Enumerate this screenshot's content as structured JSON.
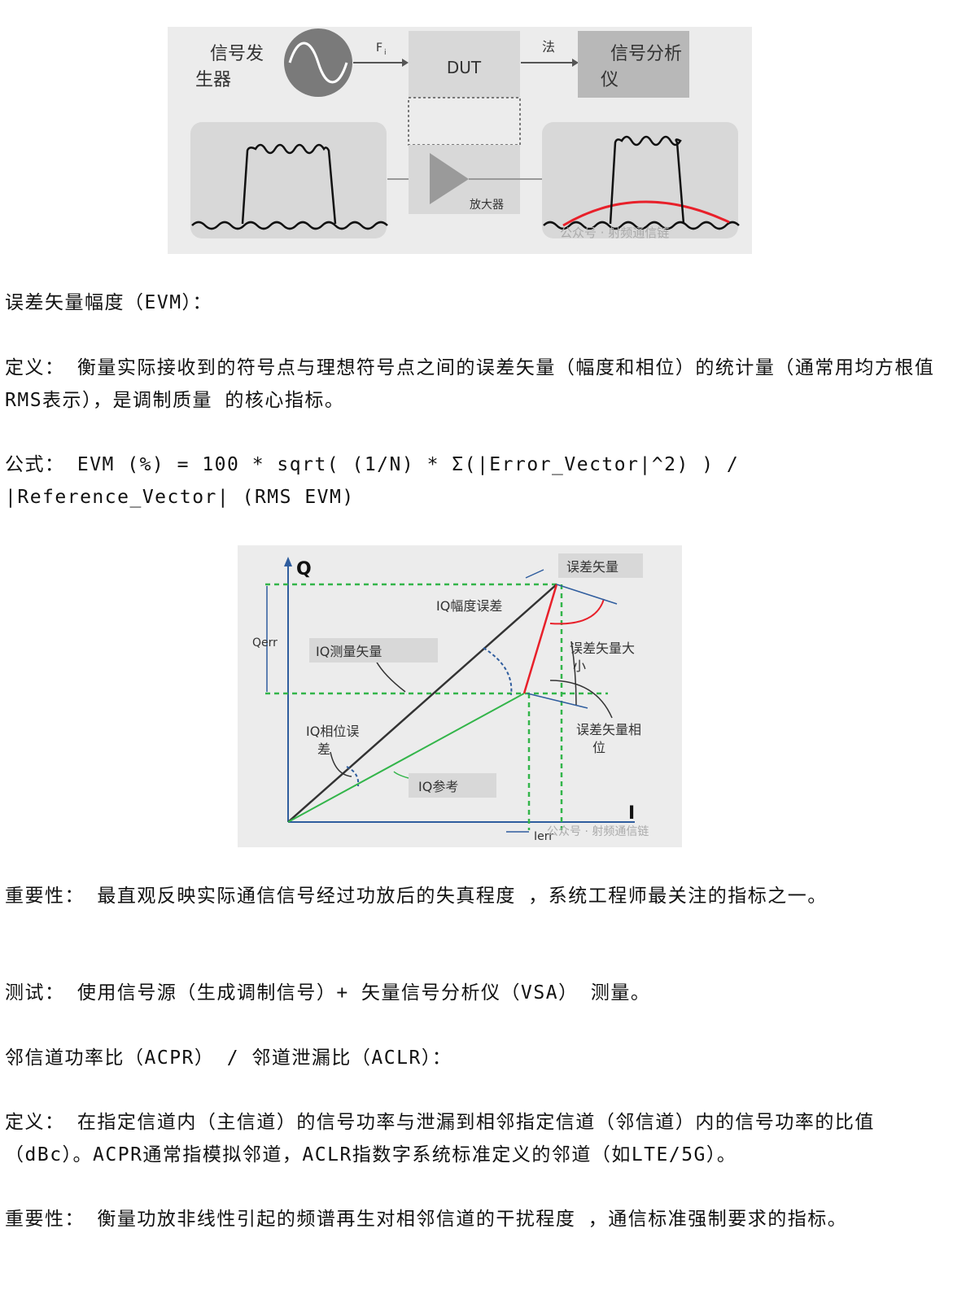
{
  "figure1": {
    "generator_label": "信号发生器",
    "generator_label_line1": "信号发",
    "generator_label_line2": "生器",
    "fi_label": "F",
    "fi_sub": "i",
    "dut_label": "DUT",
    "arrow_label": "法",
    "analyzer_label_line1": "信号分析",
    "analyzer_label_line2": "仪",
    "amplifier_label": "放大器",
    "watermark": "公众号 · 射频通信链"
  },
  "evm": {
    "heading": "误差矢量幅度（EVM）：",
    "definition": "定义： 衡量实际接收到的符号点与理想符号点之间的误差矢量（幅度和相位）的统计量（通常用均方根值RMS表示），是调制质量 的核心指标。",
    "formula_line1": "公式： EVM (%) = 100 * sqrt( (1/N) * Σ(|Error_Vector|^2) ) /",
    "formula_line2": "|Reference_Vector| (RMS EVM)",
    "importance": "重要性： 最直观反映实际通信信号经过功放后的失真程度 ，系统工程师最关注的指标之一。",
    "test": "测试： 使用信号源（生成调制信号）+ 矢量信号分析仪（VSA） 测量。"
  },
  "figure2": {
    "q_axis": "Q",
    "i_axis": "I",
    "error_vector": "误差矢量",
    "iq_mag_error": "IQ幅度误差",
    "qerr": "Qerr",
    "iq_measured": "IQ测量矢量",
    "error_vector_mag_line1": "误差矢量大",
    "error_vector_mag_line2": "小",
    "iq_phase_error_line1": "IQ相位误",
    "iq_phase_error_line2": "差",
    "error_vector_phase_line1": "误差矢量相",
    "error_vector_phase_line2": "位",
    "iq_reference": "IQ参考",
    "ierr": "Ierr",
    "watermark": "公众号 · 射频通信链"
  },
  "acpr": {
    "heading": "邻信道功率比（ACPR） / 邻道泄漏比（ACLR）：",
    "definition": "定义： 在指定信道内（主信道）的信号功率与泄漏到相邻指定信道（邻信道）内的信号功率的比值（dBc）。ACPR通常指模拟邻道，ACLR指数字系统标准定义的邻道（如LTE/5G）。",
    "importance": "重要性： 衡量功放非线性引起的频谱再生对相邻信道的干扰程度 ，通信标准强制要求的指标。"
  },
  "colors": {
    "figure_bg": "#ececec",
    "box_gray": "#d8d8d8",
    "analyzer_gray": "#b8b8b8",
    "green": "#33b54a",
    "red": "#e8202a",
    "blue": "#2f5d9e"
  }
}
